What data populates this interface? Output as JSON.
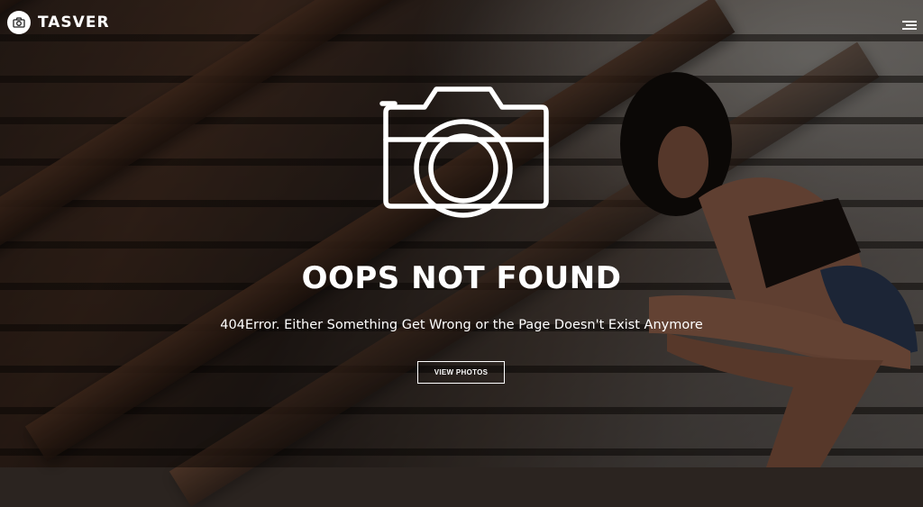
{
  "brand": {
    "name": "TASVER",
    "icon": "camera-icon"
  },
  "header": {
    "menu_icon": "hamburger-menu-icon"
  },
  "error": {
    "icon": "camera-icon",
    "title": "OOPS NOT FOUND",
    "message": "404Error. Either Something Get Wrong or the Page Doesn't Exist Anymore",
    "button_label": "VIEW PHOTOS"
  },
  "colors": {
    "text": "#ffffff",
    "overlay": "#000000"
  }
}
